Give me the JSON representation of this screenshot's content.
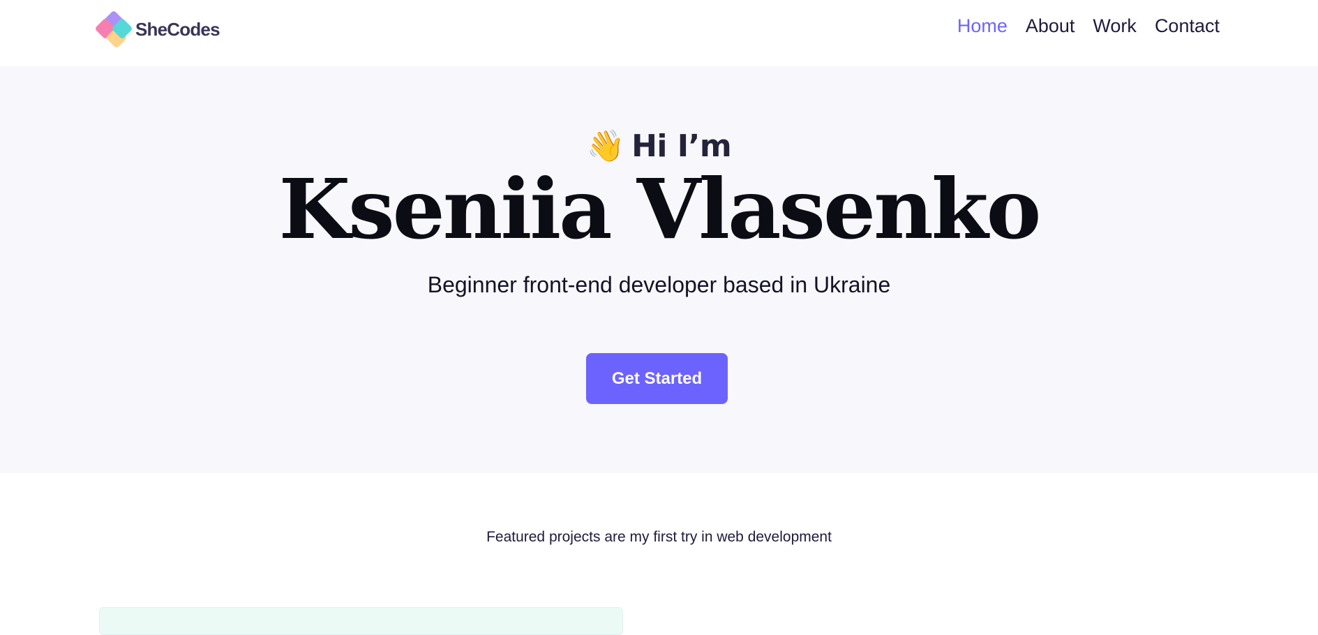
{
  "header": {
    "logo_text": "SheCodes",
    "nav": [
      {
        "label": "Home",
        "active": true
      },
      {
        "label": "About",
        "active": false
      },
      {
        "label": "Work",
        "active": false
      },
      {
        "label": "Contact",
        "active": false
      }
    ]
  },
  "hero": {
    "wave_emoji": "👋",
    "greeting": "Hi I’m",
    "name": "Kseniia Vlasenko",
    "subtitle": "Beginner front-end developer based in Ukraine",
    "cta_label": "Get Started"
  },
  "projects": {
    "intro": "Featured projects are my first try in web development"
  },
  "colors": {
    "accent": "#6c63ff",
    "hero_background": "#f7f7fc",
    "card_background": "#ecfaf6"
  },
  "icons": {
    "logo": "shecodes-logo-icon",
    "wave": "waving-hand-icon"
  }
}
